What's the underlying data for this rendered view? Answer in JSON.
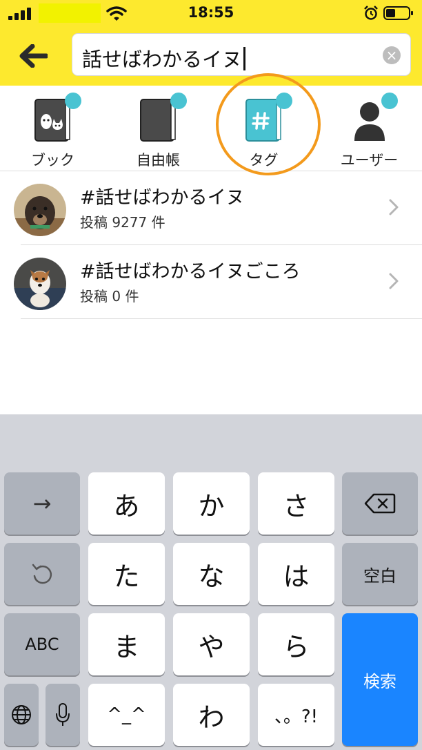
{
  "status_bar": {
    "time": "18:55"
  },
  "search": {
    "query": "話せばわかるイヌ"
  },
  "tabs": [
    {
      "label": "ブック"
    },
    {
      "label": "自由帳"
    },
    {
      "label": "タグ"
    },
    {
      "label": "ユーザー"
    }
  ],
  "results": [
    {
      "title": "#話せばわかるイヌ",
      "count": "投稿 9277 件"
    },
    {
      "title": "#話せばわかるイヌごころ",
      "count": "投稿 0 件"
    }
  ],
  "keyboard": {
    "arrow": "→",
    "a": "あ",
    "ka": "か",
    "sa": "さ",
    "ta": "た",
    "na": "な",
    "ha": "は",
    "ma": "ま",
    "ya": "や",
    "ra": "ら",
    "emoticon": "^_^",
    "wa": "わ",
    "punct": "、。?!",
    "abc": "ABC",
    "space": "空白",
    "search": "検索"
  },
  "colors": {
    "header": "#fde92e",
    "accent_teal": "#49c3d2",
    "highlight": "#f39a1c",
    "keyboard_blue": "#1a85ff"
  }
}
